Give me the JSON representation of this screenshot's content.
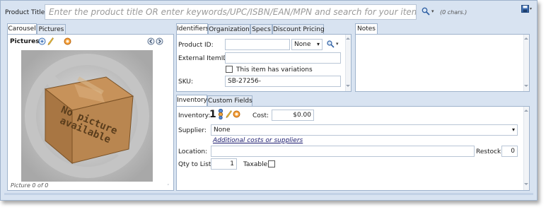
{
  "product_title": {
    "label": "Product Title:",
    "placeholder": "Enter the product title OR enter keywords/UPC/ISBN/EAN/MPN and search for your item",
    "value": "",
    "char_count": "(0 chars.)"
  },
  "left_tabs": [
    {
      "label": "Carousel",
      "active": true
    },
    {
      "label": "Pictures",
      "active": false
    }
  ],
  "carousel": {
    "pictures_label": "Pictures:",
    "image_text_line1": "No picture",
    "image_text_line2": "available",
    "caption": "Picture 0 of 0"
  },
  "identifier_tabs": [
    {
      "label": "Identifiers",
      "active": true
    },
    {
      "label": "Organization",
      "active": false
    },
    {
      "label": "Specs",
      "active": false
    },
    {
      "label": "Discount Pricing",
      "active": false
    }
  ],
  "identifiers": {
    "product_id_label": "Product ID:",
    "product_id_value": "",
    "product_id_type": "None",
    "external_item_id_label": "External ItemID:",
    "external_item_id_value": "",
    "variations_label": "This item has variations",
    "variations_checked": false,
    "sku_label": "SKU:",
    "sku_value": "SB-27256-"
  },
  "notes_tab": {
    "label": "Notes"
  },
  "inventory_tabs": [
    {
      "label": "Inventory",
      "active": true
    },
    {
      "label": "Custom Fields",
      "active": false
    }
  ],
  "inventory": {
    "inventory_label": "Inventory:",
    "inventory_value": "1",
    "cost_label": "Cost:",
    "cost_value": "$0.00",
    "supplier_label": "Supplier:",
    "supplier_value": "None",
    "additional_link": "Additional costs or suppliers",
    "location_label": "Location:",
    "location_value": "",
    "restock_label": "Restock:",
    "restock_value": "0",
    "qty_label": "Qty to List:",
    "qty_value": "1",
    "taxable_label": "Taxable:",
    "taxable_checked": false
  },
  "colors": {
    "frame_bg": "#d8e3f1",
    "border": "#9fb3cc",
    "link": "#1a1a6e"
  }
}
